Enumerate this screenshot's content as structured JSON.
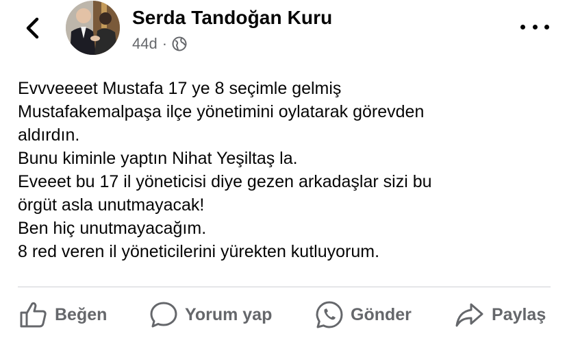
{
  "header": {
    "author_name": "Serda Tandoğan Kuru",
    "timestamp": "44d",
    "separator": "·",
    "audience_icon": "globe-icon"
  },
  "post": {
    "lines": [
      "Evvveeeet Mustafa 17 ye 8 seçimle gelmiş",
      "Mustafakemalpaşa ilçe yönetimini oylatarak görevden",
      "aldırdın.",
      "Bunu kiminle yaptın Nihat Yeşiltaş la.",
      "Eveeet bu 17 il yöneticisi diye gezen arkadaşlar sizi bu",
      "örgüt asla unutmayacak!",
      "Ben hiç unutmayacağım.",
      "8 red veren il yöneticilerini yürekten kutluyorum."
    ]
  },
  "actions": {
    "like": {
      "label": "Beğen",
      "icon": "thumbs-up-icon"
    },
    "comment": {
      "label": "Yorum yap",
      "icon": "comment-icon"
    },
    "send": {
      "label": "Gönder",
      "icon": "whatsapp-icon"
    },
    "share": {
      "label": "Paylaş",
      "icon": "share-icon"
    }
  },
  "colors": {
    "text_primary": "#050505",
    "text_secondary": "#65676b",
    "divider": "#ced0d4"
  }
}
